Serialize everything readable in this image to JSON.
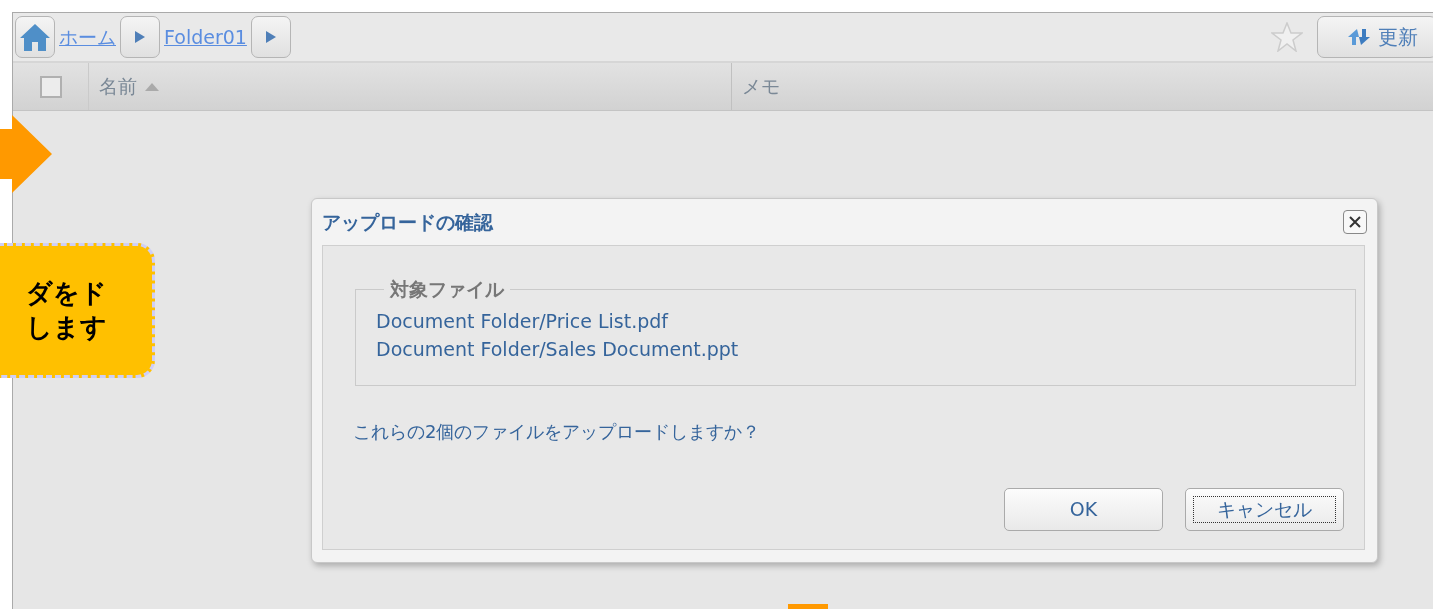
{
  "breadcrumb": {
    "home_label": "ホーム",
    "folders": [
      {
        "label": "Folder01"
      }
    ]
  },
  "toolbar": {
    "refresh_label": "更新"
  },
  "table": {
    "select_all_checked": false,
    "columns": [
      {
        "label": "名前",
        "sorted": true
      },
      {
        "label": "メモ",
        "sorted": false
      }
    ]
  },
  "callout": {
    "lines": [
      "ダをド",
      "します"
    ]
  },
  "dialog": {
    "title": "アップロードの確認",
    "group_label": "対象ファイル",
    "files": [
      "Document Folder/Price List.pdf",
      "Document Folder/Sales Document.ppt"
    ],
    "question": "これらの2個のファイルをアップロードしますか？",
    "buttons": [
      {
        "label": "OK",
        "focused": false
      },
      {
        "label": "キャンセル",
        "focused": true
      }
    ]
  }
}
